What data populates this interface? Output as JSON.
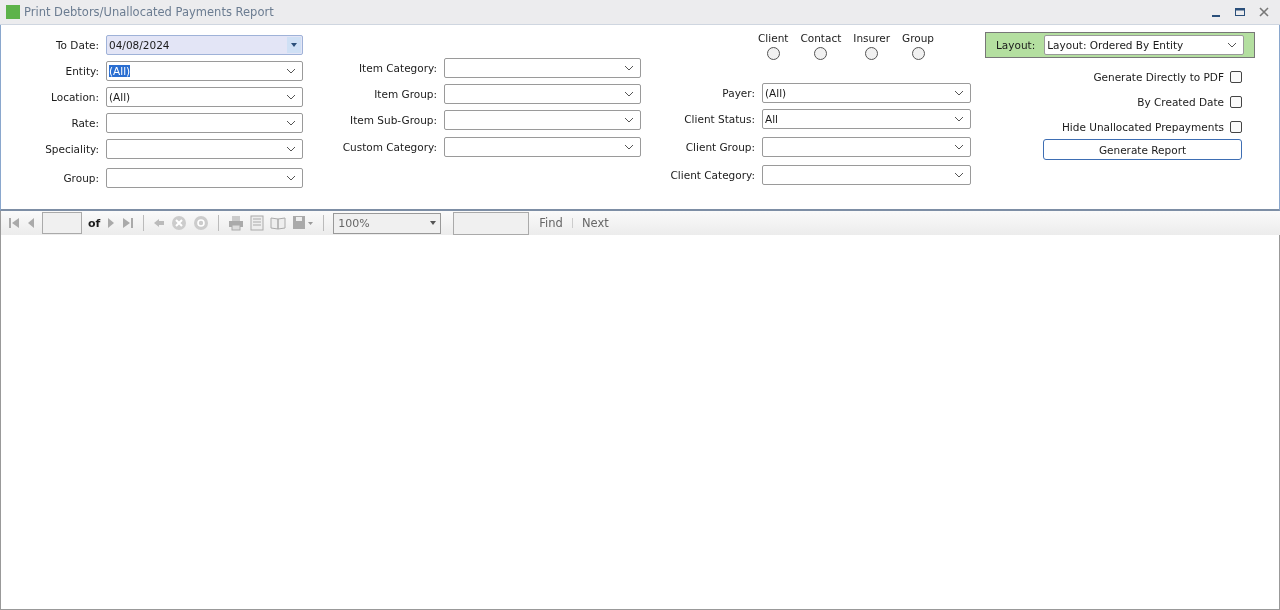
{
  "window": {
    "title": "Print Debtors/Unallocated Payments Report"
  },
  "columns": [
    {
      "fields": [
        {
          "label": "To Date:",
          "value": "04/08/2024",
          "kind": "date"
        },
        {
          "label": "Entity:",
          "value": "(All)",
          "kind": "combo",
          "highlighted": true
        },
        {
          "label": "Location:",
          "value": "(All)",
          "kind": "combo"
        },
        {
          "label": "Rate:",
          "kind": "combo"
        },
        {
          "label": "Speciality:",
          "kind": "combo"
        },
        {
          "label": "Group:",
          "kind": "combo"
        }
      ]
    },
    {
      "fields": [
        {
          "label": "Item Category:",
          "kind": "combo"
        },
        {
          "label": "Item Group:",
          "kind": "combo"
        },
        {
          "label": "Item Sub-Group:",
          "kind": "combo"
        },
        {
          "label": "Custom Category:",
          "kind": "combo"
        }
      ]
    },
    {
      "radios": [
        {
          "label": "Client",
          "selected": false
        },
        {
          "label": "Contact",
          "selected": false
        },
        {
          "label": "Insurer",
          "selected": false
        },
        {
          "label": "Group",
          "selected": false
        }
      ],
      "fields": [
        {
          "label": "Payer:",
          "value": "(All)",
          "kind": "combo"
        },
        {
          "label": "Client Status:",
          "value": "All",
          "kind": "combo"
        },
        {
          "label": "Client Group:",
          "kind": "combo"
        },
        {
          "label": "Client Category:",
          "kind": "combo"
        }
      ]
    }
  ],
  "layout": {
    "label": "Layout:",
    "value": "Layout: Ordered By Entity"
  },
  "options": [
    {
      "label": "Generate Directly to PDF",
      "checked": false
    },
    {
      "label": "By Created Date",
      "checked": false
    },
    {
      "label": "Hide Unallocated Prepayments",
      "checked": false
    }
  ],
  "generate_button": "Generate Report",
  "toolbar": {
    "of": "of",
    "zoom": "100%",
    "find": "Find",
    "next": "Next"
  }
}
